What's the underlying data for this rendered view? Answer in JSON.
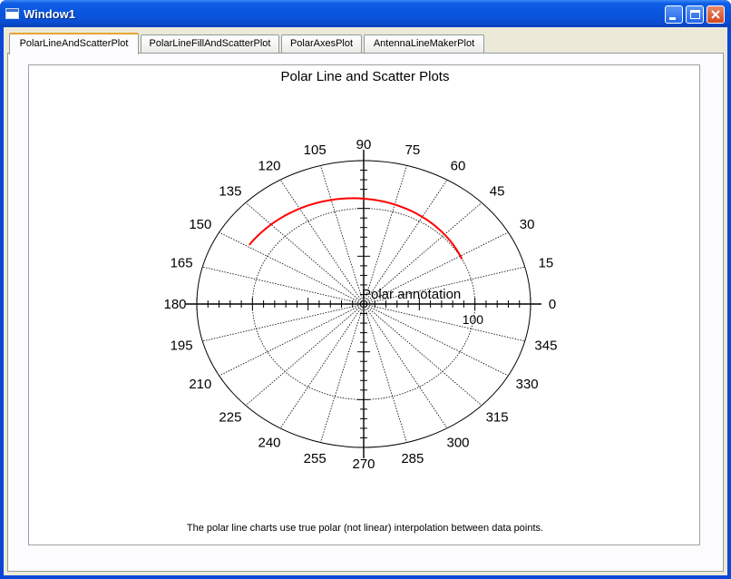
{
  "window": {
    "title": "Window1"
  },
  "tabs": [
    {
      "label": "PolarLineAndScatterPlot",
      "active": true
    },
    {
      "label": "PolarLineFillAndScatterPlot",
      "active": false
    },
    {
      "label": "PolarAxesPlot",
      "active": false
    },
    {
      "label": "AntennaLineMakerPlot",
      "active": false
    }
  ],
  "chart": {
    "title": "Polar Line and Scatter Plots",
    "caption": "The polar line charts use true polar (not linear) interpolation between data points.",
    "annotation": "Polar annotation",
    "radius_label": "100"
  },
  "chart_data": {
    "type": "line",
    "title": "Polar Line and Scatter Plots",
    "coordinate_system": "polar",
    "angle_unit": "degrees",
    "angle_ticks": [
      0,
      15,
      30,
      45,
      60,
      75,
      90,
      105,
      120,
      135,
      150,
      165,
      180,
      195,
      210,
      225,
      240,
      255,
      270,
      285,
      300,
      315,
      330,
      345
    ],
    "angle_tick_labels": [
      "0",
      "15",
      "30",
      "45",
      "60",
      "75",
      "90",
      "105",
      "120",
      "135",
      "150",
      "165",
      "180",
      "195",
      "210",
      "225",
      "240",
      "255",
      "270",
      "285",
      "300",
      "315",
      "330",
      "345"
    ],
    "radius_range": [
      0,
      150
    ],
    "radius_gridlines": [
      100,
      150
    ],
    "radius_tick_labels": [
      "100"
    ],
    "grid": true,
    "series": [
      {
        "color": "#ff0000",
        "r": [
          100,
          120
        ],
        "theta": [
          28,
          149
        ]
      }
    ],
    "annotations": [
      {
        "text": "Polar annotation",
        "r": 0,
        "theta": 0
      }
    ]
  },
  "colors": {
    "titlebar": "#0855dd",
    "client_bg": "#ece9d8",
    "tab_accent": "#e8a432",
    "series_line": "#ff0000",
    "grid": "#000000"
  }
}
